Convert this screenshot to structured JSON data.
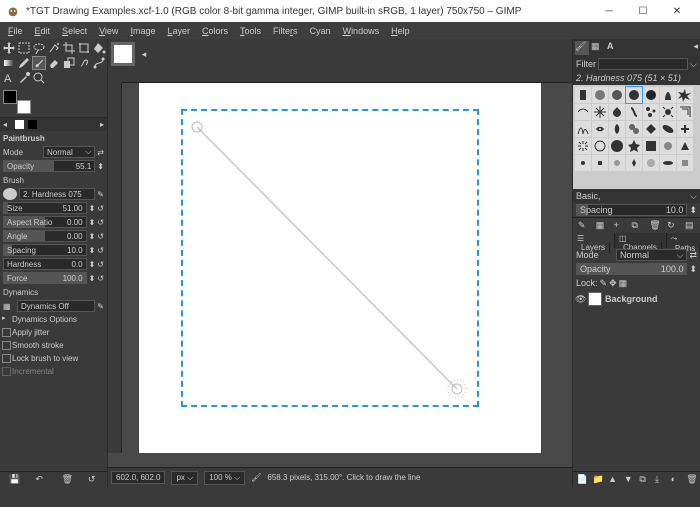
{
  "title": "*TGT Drawing Examples.xcf-1.0 (RGB color 8-bit gamma integer, GIMP built-in sRGB, 1 layer) 750x750 – GIMP",
  "menu": [
    "File",
    "Edit",
    "Select",
    "View",
    "Image",
    "Layer",
    "Colors",
    "Tools",
    "Filters",
    "Cyan",
    "Windows",
    "Help"
  ],
  "tool_options": {
    "title": "Paintbrush",
    "mode_label": "Mode",
    "mode_value": "Normal",
    "opacity_label": "Opacity",
    "opacity_value": "55.1",
    "brush_label": "Brush",
    "brush_name": "2. Hardness 075",
    "size_label": "Size",
    "size_value": "51.00",
    "aspect_label": "Aspect Ratio",
    "aspect_value": "0.00",
    "angle_label": "Angle",
    "angle_value": "0.00",
    "spacing_label": "Spacing",
    "spacing_value": "10.0",
    "hardness_label": "Hardness",
    "hardness_value": "0.0",
    "force_label": "Force",
    "force_value": "100.0",
    "dynamics_label": "Dynamics",
    "dynamics_value": "Dynamics Off",
    "opt_dyn": "Dynamics Options",
    "opt_jitter": "Apply jitter",
    "opt_smooth": "Smooth stroke",
    "opt_lock": "Lock brush to view",
    "opt_inc": "Incremental"
  },
  "brushes": {
    "filter_label": "Filter",
    "current": "2. Hardness 075 (51 × 51)",
    "category": "Basic,",
    "spacing_label": "Spacing",
    "spacing_value": "10.0"
  },
  "layers": {
    "tabs": [
      "Layers",
      "Channels",
      "Paths"
    ],
    "mode_label": "Mode",
    "mode_value": "Normal",
    "opacity_label": "Opacity",
    "opacity_value": "100.0",
    "lock_label": "Lock:",
    "layer_name": "Background"
  },
  "status": {
    "coords": "602.0, 602.0",
    "unit": "px",
    "zoom": "100 %",
    "msg": "658.3 pixels, 315.00°. Click to draw the line"
  }
}
